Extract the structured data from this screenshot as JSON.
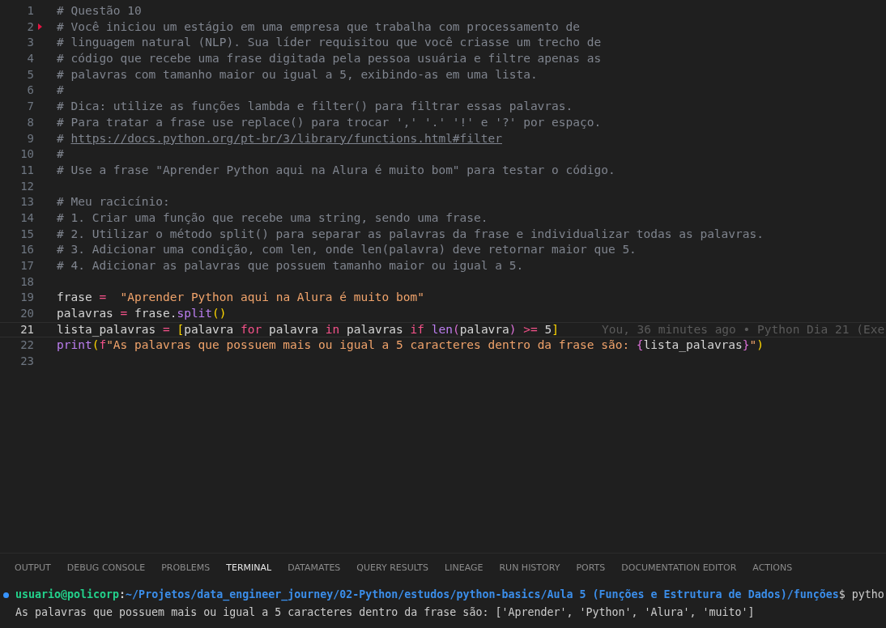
{
  "editor": {
    "lines": [
      {
        "number": "1",
        "active": false,
        "marker": false,
        "tokens": [
          {
            "kind": "comment",
            "text": "# Questão 10"
          }
        ]
      },
      {
        "number": "2",
        "active": false,
        "marker": true,
        "tokens": [
          {
            "kind": "comment",
            "text": "# Você iniciou um estágio em uma empresa que trabalha com processamento de"
          }
        ]
      },
      {
        "number": "3",
        "active": false,
        "marker": false,
        "tokens": [
          {
            "kind": "comment",
            "text": "# linguagem natural (NLP). Sua líder requisitou que você criasse um trecho de"
          }
        ]
      },
      {
        "number": "4",
        "active": false,
        "marker": false,
        "tokens": [
          {
            "kind": "comment",
            "text": "# código que recebe uma frase digitada pela pessoa usuária e filtre apenas as"
          }
        ]
      },
      {
        "number": "5",
        "active": false,
        "marker": false,
        "tokens": [
          {
            "kind": "comment",
            "text": "# palavras com tamanho maior ou igual a 5, exibindo-as em uma lista."
          }
        ]
      },
      {
        "number": "6",
        "active": false,
        "marker": false,
        "tokens": [
          {
            "kind": "comment",
            "text": "#"
          }
        ]
      },
      {
        "number": "7",
        "active": false,
        "marker": false,
        "tokens": [
          {
            "kind": "comment",
            "text": "# Dica: utilize as funções lambda e filter() para filtrar essas palavras."
          }
        ]
      },
      {
        "number": "8",
        "active": false,
        "marker": false,
        "tokens": [
          {
            "kind": "comment",
            "text": "# Para tratar a frase use replace() para trocar ',' '.' '!' e '?' por espaço."
          }
        ]
      },
      {
        "number": "9",
        "active": false,
        "marker": false,
        "tokens": [
          {
            "kind": "comment",
            "text": "# "
          },
          {
            "kind": "link",
            "text": "https://docs.python.org/pt-br/3/library/functions.html#filter"
          }
        ]
      },
      {
        "number": "10",
        "active": false,
        "marker": false,
        "tokens": [
          {
            "kind": "comment",
            "text": "#"
          }
        ]
      },
      {
        "number": "11",
        "active": false,
        "marker": false,
        "tokens": [
          {
            "kind": "comment",
            "text": "# Use a frase \"Aprender Python aqui na Alura é muito bom\" para testar o código."
          }
        ]
      },
      {
        "number": "12",
        "active": false,
        "marker": false
      },
      {
        "number": "13",
        "active": false,
        "marker": false,
        "tokens": [
          {
            "kind": "comment",
            "text": "# Meu racicínio:"
          }
        ]
      },
      {
        "number": "14",
        "active": false,
        "marker": false,
        "tokens": [
          {
            "kind": "comment",
            "text": "# 1. Criar uma função que recebe uma string, sendo uma frase."
          }
        ]
      },
      {
        "number": "15",
        "active": false,
        "marker": false,
        "tokens": [
          {
            "kind": "comment",
            "text": "# 2. Utilizar o método split() para separar as palavras da frase e individualizar todas as palavras."
          }
        ]
      },
      {
        "number": "16",
        "active": false,
        "marker": false,
        "tokens": [
          {
            "kind": "comment",
            "text": "# 3. Adicionar uma condição, com len, onde len(palavra) deve retornar maior que 5."
          }
        ]
      },
      {
        "number": "17",
        "active": false,
        "marker": false,
        "tokens": [
          {
            "kind": "comment",
            "text": "# 4. Adicionar as palavras que possuem tamanho maior ou igual a 5."
          }
        ]
      },
      {
        "number": "18",
        "active": false,
        "marker": false
      },
      {
        "number": "19",
        "active": false,
        "marker": false,
        "tokens": [
          {
            "kind": "plain",
            "text": "frase "
          },
          {
            "kind": "op",
            "text": "=  "
          },
          {
            "kind": "string",
            "text": "\"Aprender Python aqui na Alura é muito bom\""
          }
        ]
      },
      {
        "number": "20",
        "active": false,
        "marker": false,
        "tokens": [
          {
            "kind": "plain",
            "text": "palavras "
          },
          {
            "kind": "op",
            "text": "="
          },
          {
            "kind": "plain",
            "text": " frase."
          },
          {
            "kind": "func",
            "text": "split"
          },
          {
            "kind": "bracket",
            "text": "()"
          }
        ]
      },
      {
        "number": "21",
        "active": true,
        "marker": false,
        "blame": "You, 36 minutes ago • Python Dia 21 (Exe",
        "tokens": [
          {
            "kind": "plain",
            "text": "lista_palavras "
          },
          {
            "kind": "op",
            "text": "= "
          },
          {
            "kind": "bracket",
            "text": "["
          },
          {
            "kind": "plain",
            "text": "palavra "
          },
          {
            "kind": "keyword",
            "text": "for"
          },
          {
            "kind": "plain",
            "text": " palavra "
          },
          {
            "kind": "keyword",
            "text": "in"
          },
          {
            "kind": "plain",
            "text": " palavras "
          },
          {
            "kind": "keyword",
            "text": "if "
          },
          {
            "kind": "func",
            "text": "len"
          },
          {
            "kind": "bracket2",
            "text": "("
          },
          {
            "kind": "plain",
            "text": "palavra"
          },
          {
            "kind": "bracket2",
            "text": ")"
          },
          {
            "kind": "op",
            "text": " >="
          },
          {
            "kind": "plain",
            "text": " 5"
          },
          {
            "kind": "bracket",
            "text": "]"
          }
        ]
      },
      {
        "number": "22",
        "active": false,
        "marker": false,
        "tokens": [
          {
            "kind": "func",
            "text": "print"
          },
          {
            "kind": "bracket",
            "text": "("
          },
          {
            "kind": "keyword",
            "text": "f"
          },
          {
            "kind": "string",
            "text": "\"As palavras que possuem mais ou igual a 5 caracteres dentro da frase são: "
          },
          {
            "kind": "bracket2",
            "text": "{"
          },
          {
            "kind": "plain",
            "text": "lista_palavras"
          },
          {
            "kind": "bracket2",
            "text": "}"
          },
          {
            "kind": "string",
            "text": "\""
          },
          {
            "kind": "bracket",
            "text": ")"
          }
        ]
      },
      {
        "number": "23",
        "active": false,
        "marker": false
      }
    ]
  },
  "panel": {
    "tabs": [
      {
        "label": "OUTPUT",
        "selected": false
      },
      {
        "label": "DEBUG CONSOLE",
        "selected": false
      },
      {
        "label": "PROBLEMS",
        "selected": false
      },
      {
        "label": "TERMINAL",
        "selected": true
      },
      {
        "label": "DATAMATES",
        "selected": false
      },
      {
        "label": "QUERY RESULTS",
        "selected": false
      },
      {
        "label": "LINEAGE",
        "selected": false
      },
      {
        "label": "RUN HISTORY",
        "selected": false
      },
      {
        "label": "PORTS",
        "selected": false
      },
      {
        "label": "DOCUMENTATION EDITOR",
        "selected": false
      },
      {
        "label": "ACTIONS",
        "selected": false
      }
    ],
    "terminal": {
      "user": "usuario@policorp",
      "separator": ":",
      "path": "~/Projetos/data_engineer_journey/02-Python/estudos/python-basics/Aula 5 (Funções e Estrutura de Dados)/funções",
      "command": "$ pytho",
      "output": "As palavras que possuem mais ou igual a 5 caracteres dentro da frase são: ['Aprender', 'Python', 'Alura', 'muito']"
    }
  }
}
